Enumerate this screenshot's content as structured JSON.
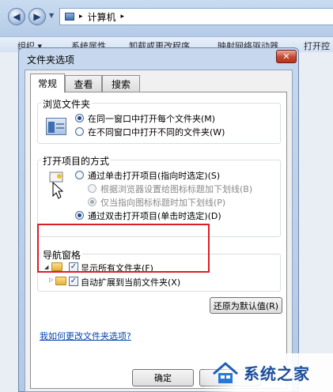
{
  "explorer": {
    "breadcrumb": "计算机",
    "toolbar_items": [
      "组织 ▾",
      "系统属性",
      "卸载或更改程序",
      "映射网络驱动器",
      "打开控"
    ]
  },
  "dialog": {
    "title": "文件夹选项",
    "close_label": "✕",
    "tabs": [
      "常规",
      "查看",
      "搜索"
    ],
    "browse_group": {
      "legend": "浏览文件夹",
      "options": [
        "在同一窗口中打开每个文件夹(M)",
        "在不同窗口中打开不同的文件夹(W)"
      ],
      "selected": 0
    },
    "open_group": {
      "legend": "打开项目的方式",
      "single_click": "通过单击打开项目(指向时选定)(S)",
      "sub_option_1": "根据浏览器设置给图标标题加下划线(B)",
      "sub_option_2": "仅当指向图标标题时加下划线(P)",
      "double_click": "通过双击打开项目(单击时选定)(D)",
      "selected": "double_click"
    },
    "nav_group": {
      "legend": "导航窗格",
      "show_all_folders": "显示所有文件夹(F)",
      "show_all_checked": true,
      "auto_expand": "自动扩展到当前文件夹(X)",
      "auto_expand_checked": true,
      "check_mark": "✓"
    },
    "restore_button": "还原为默认值(R)",
    "help_link": "我如何更改文件夹选项?",
    "ok_button": "确定"
  },
  "watermark": {
    "text": "系统之家"
  },
  "colors": {
    "highlight_border": "#e01c24",
    "link": "#0645ad"
  }
}
